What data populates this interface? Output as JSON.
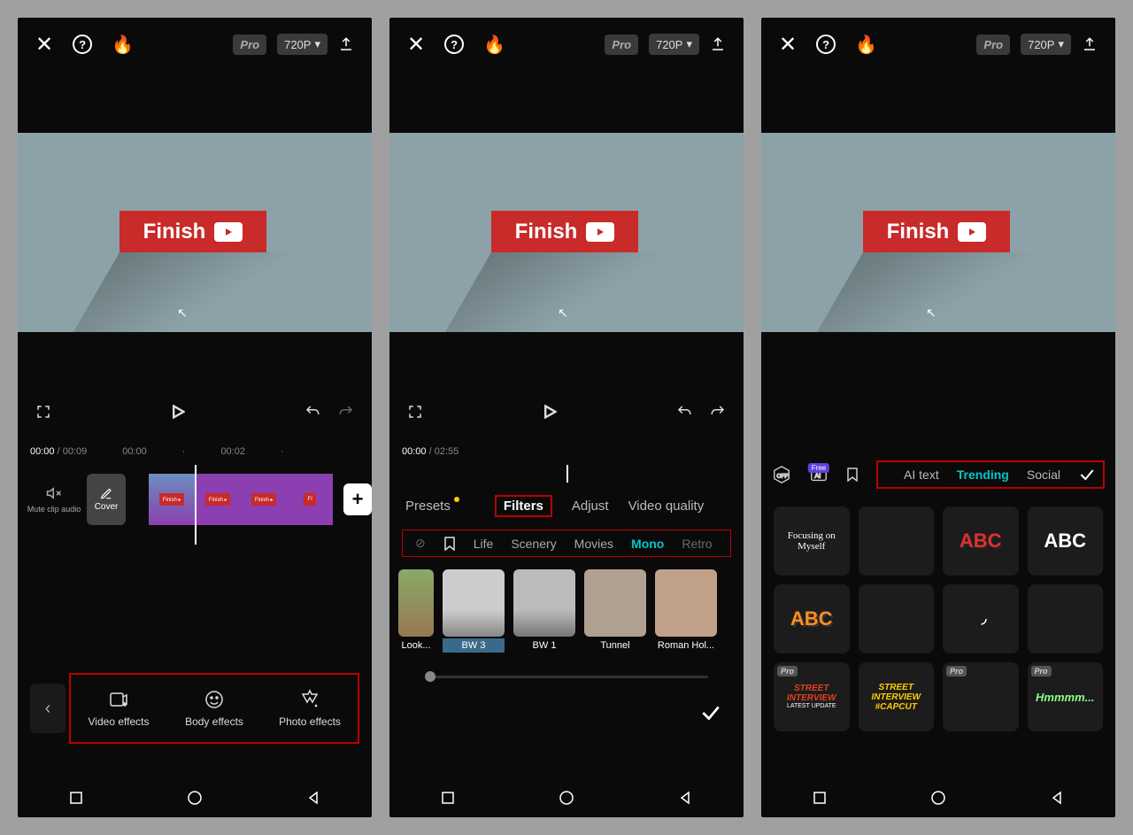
{
  "topbar": {
    "pro": "Pro",
    "resolution": "720P"
  },
  "preview": {
    "finish_label": "Finish"
  },
  "timeline1": {
    "current": "00:00",
    "total": "00:09",
    "t1": "00:00",
    "t2": "00:02"
  },
  "timeline2": {
    "current": "00:00",
    "total": "02:55"
  },
  "mute_label": "Mute clip audio",
  "cover_label": "Cover",
  "add_label": "+",
  "bottom": {
    "video_effects": "Video effects",
    "body_effects": "Body effects",
    "photo_effects": "Photo effects"
  },
  "filters": {
    "tabs": {
      "presets": "Presets",
      "filters": "Filters",
      "adjust": "Adjust",
      "quality": "Video quality"
    },
    "cats": {
      "life": "Life",
      "scenery": "Scenery",
      "movies": "Movies",
      "mono": "Mono",
      "retro": "Retro"
    },
    "thumbs": {
      "look": "Look...",
      "bw3": "BW 3",
      "bw1": "BW 1",
      "tunnel": "Tunnel",
      "roman": "Roman Hol..."
    }
  },
  "text": {
    "tabs": {
      "ai": "AI text",
      "trending": "Trending",
      "social": "Social"
    },
    "free": "Free",
    "tiles": {
      "focusing": "Focusing on Myself",
      "abc": "ABC",
      "street1_a": "STREET INTERVIEW",
      "street1_b": "LATEST UPDATE",
      "street2_a": "STREET",
      "street2_b": "INTERVIEW",
      "street2_c": "#CAPCUT",
      "hmm": "Hmmmm..."
    }
  }
}
